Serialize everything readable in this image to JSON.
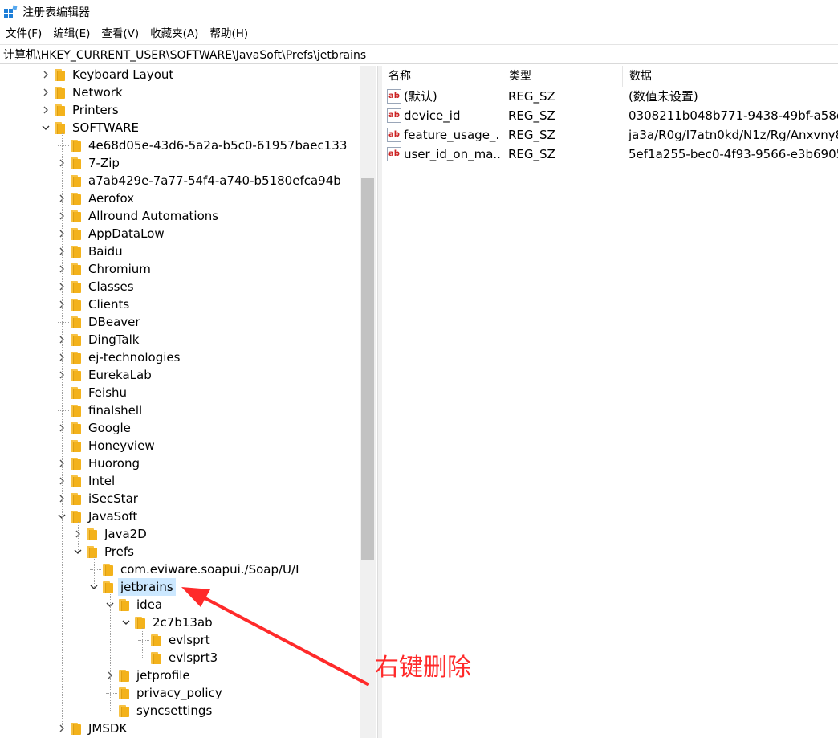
{
  "window": {
    "title": "注册表编辑器",
    "icon": "registry-editor-icon"
  },
  "menu": [
    {
      "label": "文件(F)"
    },
    {
      "label": "编辑(E)"
    },
    {
      "label": "查看(V)"
    },
    {
      "label": "收藏夹(A)"
    },
    {
      "label": "帮助(H)"
    }
  ],
  "address": "计算机\\HKEY_CURRENT_USER\\SOFTWARE\\JavaSoft\\Prefs\\jetbrains",
  "tree": {
    "nodes": [
      {
        "label": "Keyboard Layout",
        "depth": 0,
        "toggle": "collapsed"
      },
      {
        "label": "Network",
        "depth": 0,
        "toggle": "collapsed"
      },
      {
        "label": "Printers",
        "depth": 0,
        "toggle": "collapsed"
      },
      {
        "label": "SOFTWARE",
        "depth": 0,
        "toggle": "expanded"
      },
      {
        "label": "4e68d05e-43d6-5a2a-b5c0-61957baec133",
        "depth": 1,
        "toggle": "none"
      },
      {
        "label": "7-Zip",
        "depth": 1,
        "toggle": "collapsed"
      },
      {
        "label": "a7ab429e-7a77-54f4-a740-b5180efca94b",
        "depth": 1,
        "toggle": "none"
      },
      {
        "label": "Aerofox",
        "depth": 1,
        "toggle": "collapsed"
      },
      {
        "label": "Allround Automations",
        "depth": 1,
        "toggle": "collapsed"
      },
      {
        "label": "AppDataLow",
        "depth": 1,
        "toggle": "collapsed"
      },
      {
        "label": "Baidu",
        "depth": 1,
        "toggle": "collapsed"
      },
      {
        "label": "Chromium",
        "depth": 1,
        "toggle": "collapsed"
      },
      {
        "label": "Classes",
        "depth": 1,
        "toggle": "collapsed"
      },
      {
        "label": "Clients",
        "depth": 1,
        "toggle": "collapsed"
      },
      {
        "label": "DBeaver",
        "depth": 1,
        "toggle": "none"
      },
      {
        "label": "DingTalk",
        "depth": 1,
        "toggle": "collapsed"
      },
      {
        "label": "ej-technologies",
        "depth": 1,
        "toggle": "collapsed"
      },
      {
        "label": "EurekaLab",
        "depth": 1,
        "toggle": "collapsed"
      },
      {
        "label": "Feishu",
        "depth": 1,
        "toggle": "none"
      },
      {
        "label": "finalshell",
        "depth": 1,
        "toggle": "none"
      },
      {
        "label": "Google",
        "depth": 1,
        "toggle": "collapsed"
      },
      {
        "label": "Honeyview",
        "depth": 1,
        "toggle": "none"
      },
      {
        "label": "Huorong",
        "depth": 1,
        "toggle": "collapsed"
      },
      {
        "label": "Intel",
        "depth": 1,
        "toggle": "collapsed"
      },
      {
        "label": "iSecStar",
        "depth": 1,
        "toggle": "collapsed"
      },
      {
        "label": "JavaSoft",
        "depth": 1,
        "toggle": "expanded"
      },
      {
        "label": "Java2D",
        "depth": 2,
        "toggle": "collapsed"
      },
      {
        "label": "Prefs",
        "depth": 2,
        "toggle": "expanded"
      },
      {
        "label": "com.eviware.soapui./Soap/U/I",
        "depth": 3,
        "toggle": "none"
      },
      {
        "label": "jetbrains",
        "depth": 3,
        "toggle": "expanded",
        "selected": true
      },
      {
        "label": "idea",
        "depth": 4,
        "toggle": "expanded"
      },
      {
        "label": "2c7b13ab",
        "depth": 5,
        "toggle": "expanded"
      },
      {
        "label": "evlsprt",
        "depth": 6,
        "toggle": "none"
      },
      {
        "label": "evlsprt3",
        "depth": 6,
        "toggle": "none"
      },
      {
        "label": "jetprofile",
        "depth": 4,
        "toggle": "collapsed"
      },
      {
        "label": "privacy_policy",
        "depth": 4,
        "toggle": "none"
      },
      {
        "label": "syncsettings",
        "depth": 4,
        "toggle": "none"
      },
      {
        "label": "JMSDK",
        "depth": 1,
        "toggle": "collapsed"
      }
    ]
  },
  "list": {
    "columns": [
      "名称",
      "类型",
      "数据"
    ],
    "rows": [
      {
        "name": "(默认)",
        "type": "REG_SZ",
        "data": "(数值未设置)"
      },
      {
        "name": "device_id",
        "type": "REG_SZ",
        "data": "0308211b048b771-9438-49bf-a58e"
      },
      {
        "name": "feature_usage_...",
        "type": "REG_SZ",
        "data": "ja3a/R0g/I7atn0kd/N1z/Rg/Anxvny8"
      },
      {
        "name": "user_id_on_ma...",
        "type": "REG_SZ",
        "data": "5ef1a255-bec0-4f93-9566-e3b6905"
      }
    ],
    "value_icon_text": "ab"
  },
  "annotation": {
    "text": "右键删除",
    "color": "#ff2a2a"
  }
}
